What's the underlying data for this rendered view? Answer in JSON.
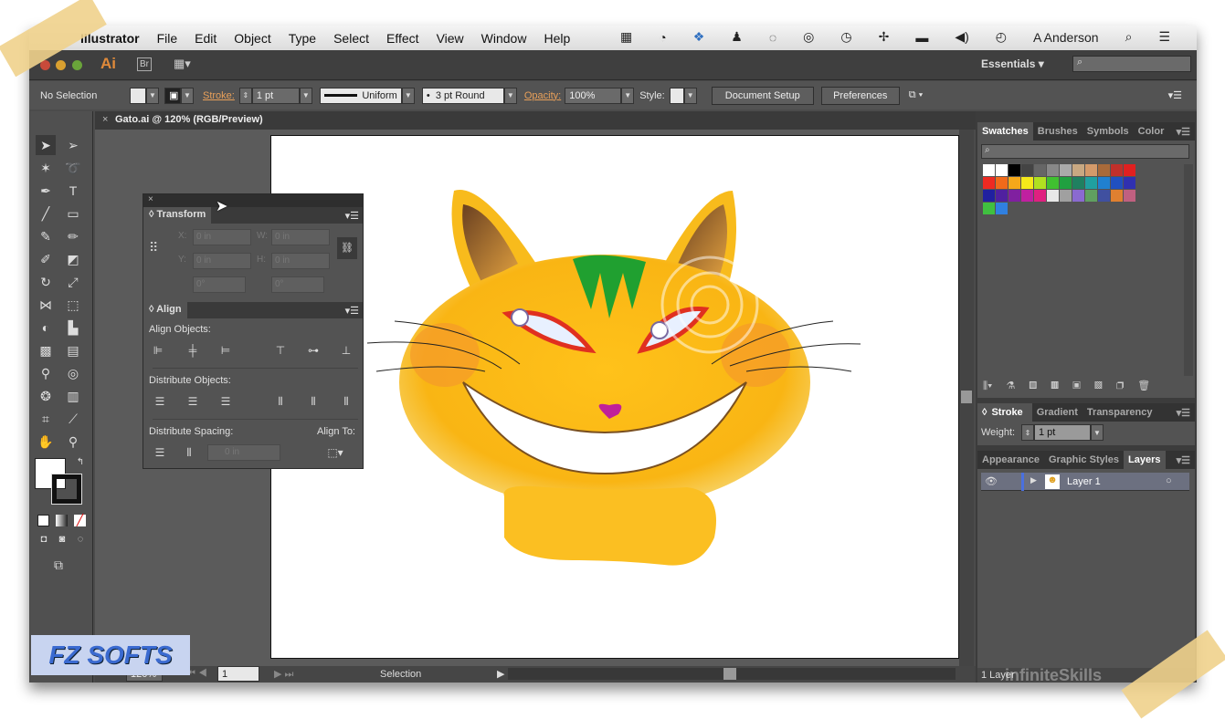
{
  "menubar": {
    "app": "Illustrator",
    "items": [
      "File",
      "Edit",
      "Object",
      "Type",
      "Select",
      "Effect",
      "View",
      "Window",
      "Help"
    ],
    "user": "A Anderson"
  },
  "appbar": {
    "logo": "Ai",
    "bridge": "Br",
    "workspace": "Essentials",
    "search_placeholder": ""
  },
  "control": {
    "selection": "No Selection",
    "stroke_label": "Stroke:",
    "stroke_value": "1 pt",
    "profile": "Uniform",
    "brush": "3 pt Round",
    "opacity_label": "Opacity:",
    "opacity_value": "100%",
    "style_label": "Style:",
    "document_setup": "Document Setup",
    "preferences": "Preferences"
  },
  "document": {
    "tab": "Gato.ai @ 120% (RGB/Preview)"
  },
  "transform": {
    "title": "Transform",
    "x_label": "X:",
    "y_label": "Y:",
    "w_label": "W:",
    "h_label": "H:",
    "x": "0 in",
    "y": "0 in",
    "w": "0 in",
    "h": "0 in",
    "rotate": "0°",
    "shear": "0°"
  },
  "align": {
    "title": "Align",
    "align_objects": "Align Objects:",
    "distribute_objects": "Distribute Objects:",
    "distribute_spacing": "Distribute Spacing:",
    "align_to": "Align To:",
    "spacing_value": "0 in"
  },
  "swatches": {
    "tabs": [
      "Swatches",
      "Brushes",
      "Symbols",
      "Color"
    ],
    "colors": [
      "#ffffff",
      "#ffffff",
      "#000000",
      "#444444",
      "#666666",
      "#888888",
      "#aaaaaa",
      "#c8a882",
      "#d49a6a",
      "#a86a3a",
      "#c0302a",
      "#e02020",
      "#ee2a22",
      "#f06a1a",
      "#f5a81a",
      "#f5e81a",
      "#b0e020",
      "#40c030",
      "#20a040",
      "#208060",
      "#20a0a0",
      "#2080d0",
      "#2050c0",
      "#3030b0",
      "#2020a0",
      "#5020a0",
      "#8020a0",
      "#c020a0",
      "#e02080",
      "#e8e8e8",
      "#a0a0a0",
      "#8a6ad0",
      "#60a060",
      "#4050a0",
      "#e08030",
      "#c06080",
      "#40c040",
      "#3080e0"
    ]
  },
  "stroke_panel": {
    "tabs": [
      "Stroke",
      "Gradient",
      "Transparency"
    ],
    "weight_label": "Weight:",
    "weight": "1 pt"
  },
  "layers_panel": {
    "tabs": [
      "Appearance",
      "Graphic Styles",
      "Layers"
    ],
    "layer": "Layer 1",
    "count": "1 Layer"
  },
  "status": {
    "zoom": "120%",
    "page": "1",
    "tool": "Selection"
  },
  "watermark": {
    "logo": "FZ SOFTS",
    "brand": "infiniteSkills"
  }
}
